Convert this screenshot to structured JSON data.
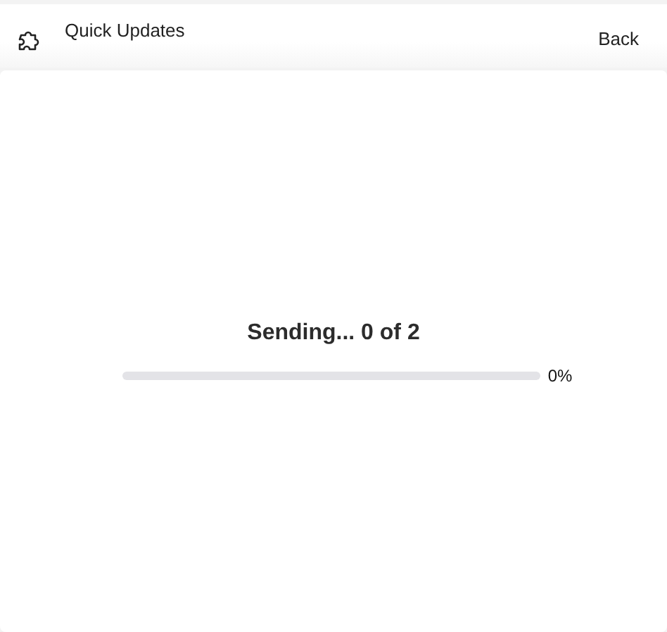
{
  "header": {
    "title": "Quick Updates",
    "back": "Back"
  },
  "progress": {
    "status": "Sending... 0 of 2",
    "level": 0,
    "reading": "0%"
  }
}
